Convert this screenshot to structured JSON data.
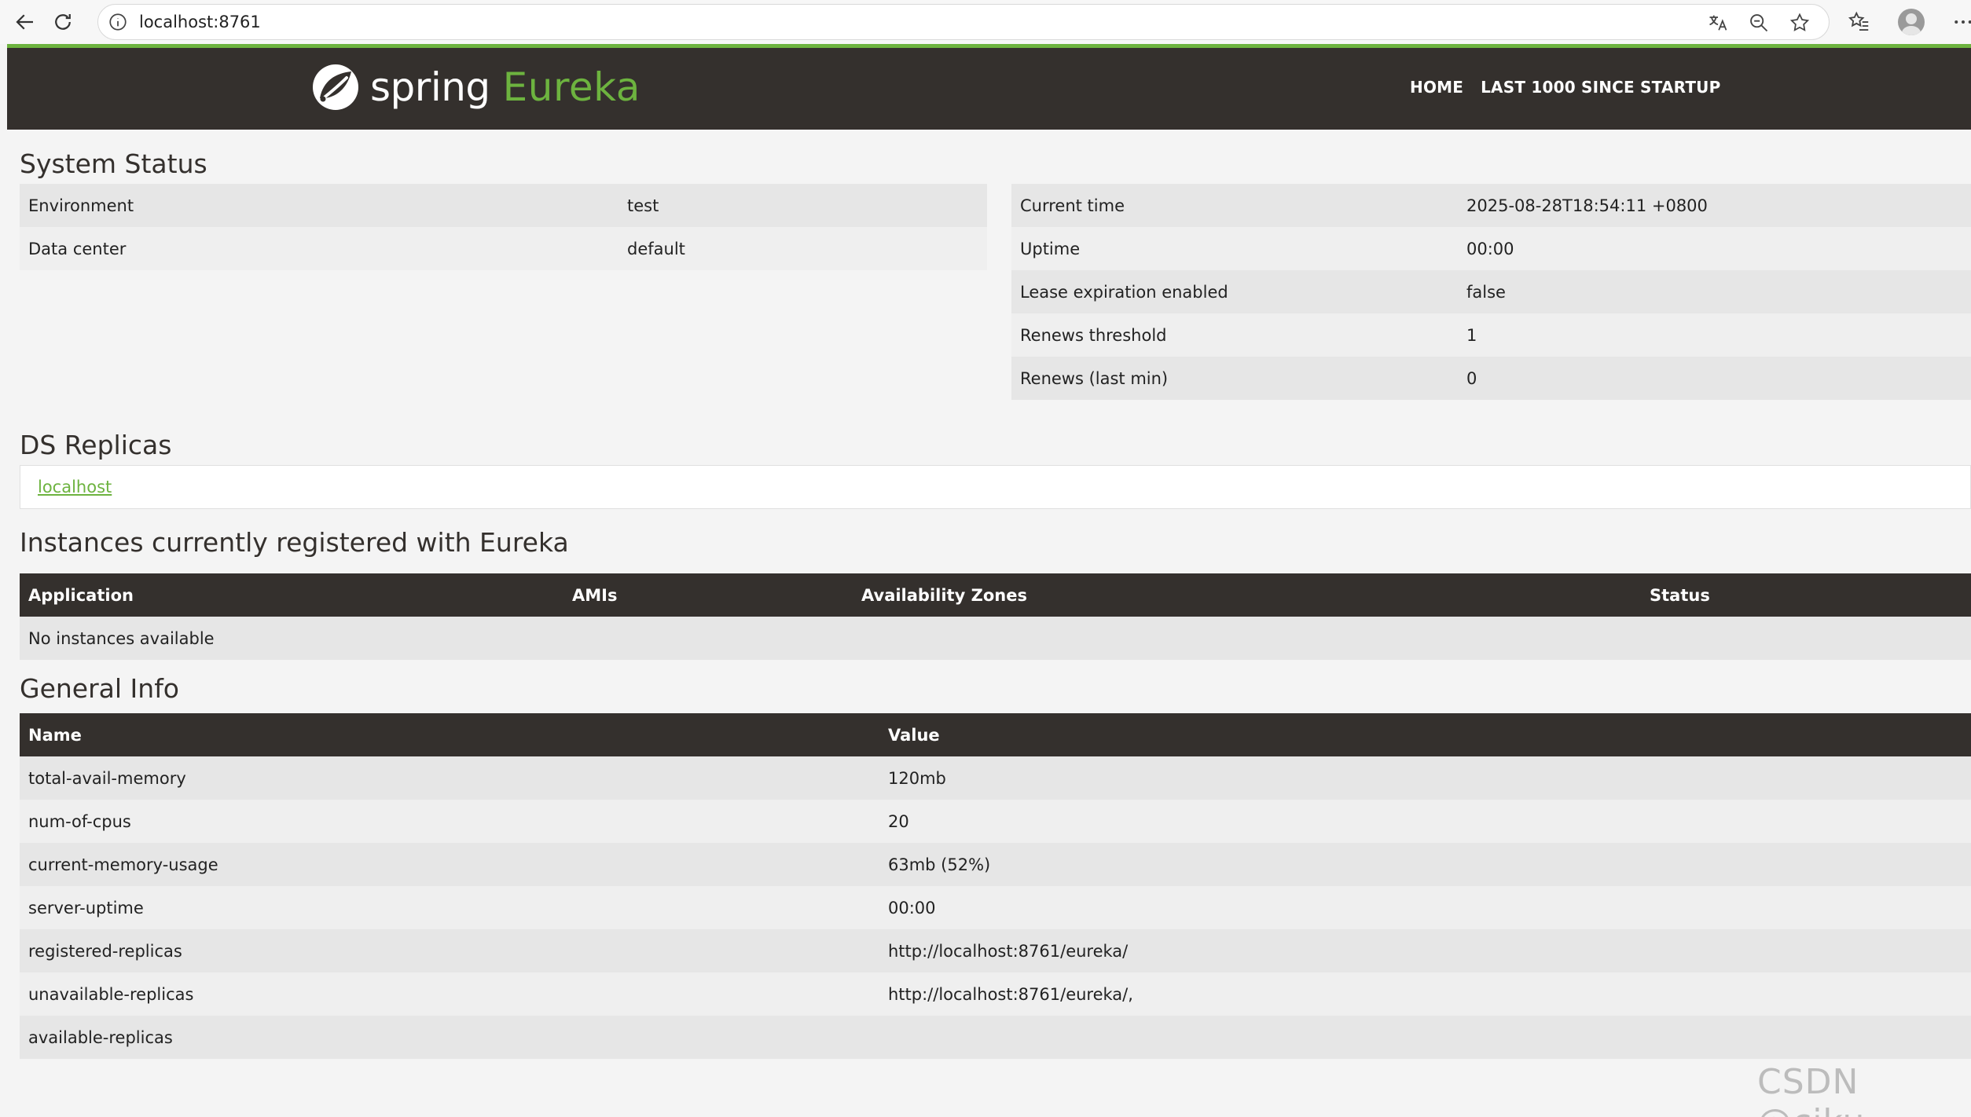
{
  "browser": {
    "url": "localhost:8761"
  },
  "header": {
    "logo_spring": "spring",
    "logo_eureka": "Eureka",
    "nav": [
      {
        "label": "HOME"
      },
      {
        "label": "LAST 1000 SINCE STARTUP"
      }
    ]
  },
  "system_status": {
    "title": "System Status",
    "left": [
      {
        "key": "Environment",
        "value": "test"
      },
      {
        "key": "Data center",
        "value": "default"
      }
    ],
    "right": [
      {
        "key": "Current time",
        "value": "2025-08-28T18:54:11 +0800"
      },
      {
        "key": "Uptime",
        "value": "00:00"
      },
      {
        "key": "Lease expiration enabled",
        "value": "false"
      },
      {
        "key": "Renews threshold",
        "value": "1"
      },
      {
        "key": "Renews (last min)",
        "value": "0"
      }
    ]
  },
  "ds_replicas": {
    "title": "DS Replicas",
    "link": "localhost"
  },
  "instances": {
    "title": "Instances currently registered with Eureka",
    "columns": [
      "Application",
      "AMIs",
      "Availability Zones",
      "Status"
    ],
    "empty_text": "No instances available"
  },
  "general_info": {
    "title": "General Info",
    "columns": [
      "Name",
      "Value"
    ],
    "rows": [
      {
        "name": "total-avail-memory",
        "value": "120mb"
      },
      {
        "name": "num-of-cpus",
        "value": "20"
      },
      {
        "name": "current-memory-usage",
        "value": "63mb (52%)"
      },
      {
        "name": "server-uptime",
        "value": "00:00"
      },
      {
        "name": "registered-replicas",
        "value": "http://localhost:8761/eureka/"
      },
      {
        "name": "unavailable-replicas",
        "value": "http://localhost:8761/eureka/,"
      },
      {
        "name": "available-replicas",
        "value": ""
      }
    ]
  },
  "watermark": "CSDN @ciku",
  "colors": {
    "brand_green": "#6db33f",
    "header_dark": "#34302d"
  }
}
